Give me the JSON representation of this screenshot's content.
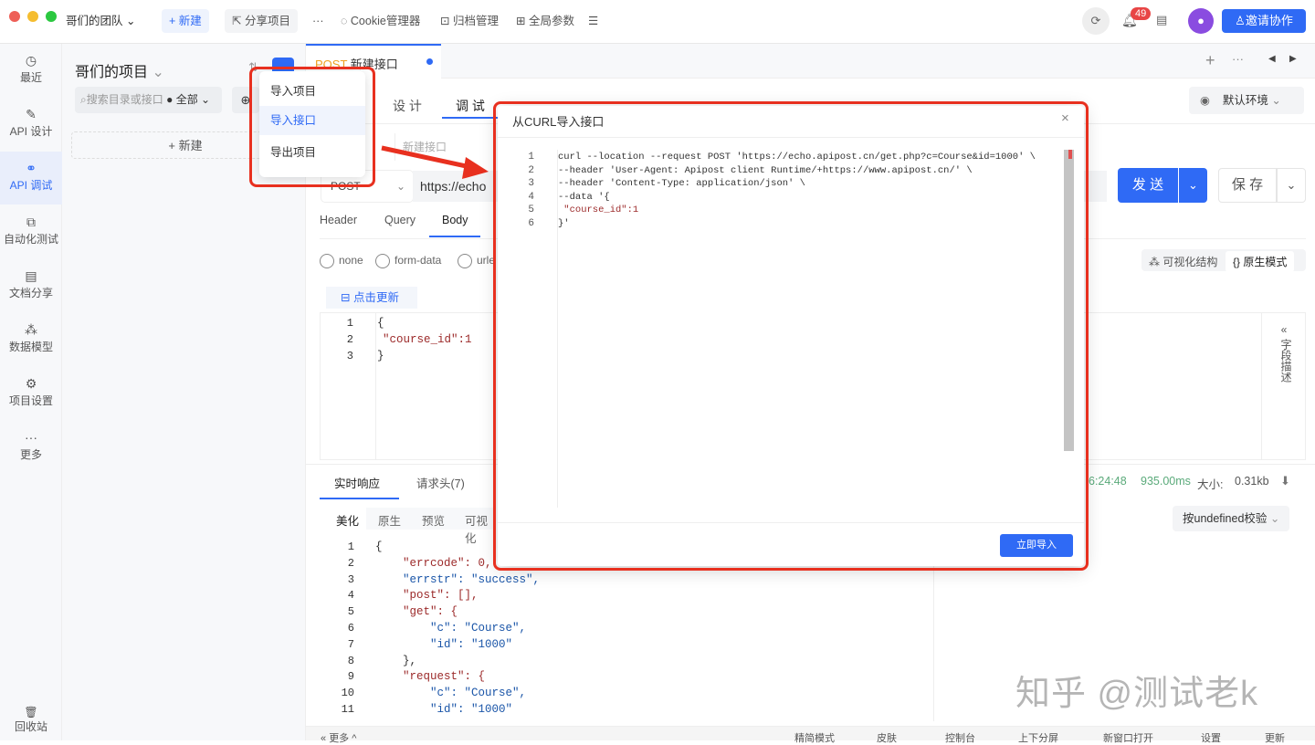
{
  "topbar": {
    "team": "哥们的团队",
    "new_label": "+ 新建",
    "share_label": "分享项目",
    "more": "···",
    "cookie_label": "Cookie管理器",
    "archive_label": "归档管理",
    "global_params_label": "全局参数",
    "notification_count": "49",
    "invite_label": "邀请协作"
  },
  "leftnav": [
    {
      "label": "最近",
      "icon": "clock-icon",
      "glyph": "◷"
    },
    {
      "label": "API 设计",
      "icon": "edit-icon",
      "glyph": "✎"
    },
    {
      "label": "API 调试",
      "icon": "link-icon",
      "glyph": "⚭"
    },
    {
      "label": "自动化测试",
      "icon": "flow-icon",
      "glyph": "⧉"
    },
    {
      "label": "文档分享",
      "icon": "doc-icon",
      "glyph": "▤"
    },
    {
      "label": "数据模型",
      "icon": "model-icon",
      "glyph": "⁂"
    },
    {
      "label": "项目设置",
      "icon": "settings-icon",
      "glyph": "⚙"
    },
    {
      "label": "更多",
      "icon": "more-icon",
      "glyph": "···"
    }
  ],
  "trash_label": "回收站",
  "project": {
    "title": "哥们的项目",
    "search_placeholder": "搜索目录或接口",
    "filter": "全部",
    "new_label": "+ 新建"
  },
  "import_menu": [
    "导入项目",
    "导入接口",
    "导出项目"
  ],
  "tab": {
    "method": "POST",
    "name": "新建接口"
  },
  "subtabs": [
    "设 计",
    "调 试"
  ],
  "env": "默认环境",
  "request": {
    "name_placeholder": "新建接口",
    "method": "POST",
    "url": "https://echo",
    "send": "发 送",
    "save": "保 存"
  },
  "param_tabs": [
    "Header",
    "Query",
    "Body"
  ],
  "body_types": [
    "none",
    "form-data",
    "urle"
  ],
  "refresh_label": "点击更新",
  "view_modes": [
    "可视化结构",
    "原生模式"
  ],
  "field_desc": "字段描述",
  "body_code": [
    "{",
    "\"course_id\":1",
    "}"
  ],
  "response": {
    "tabs": [
      "实时响应",
      "请求头(7)"
    ],
    "time": "6:24:48",
    "duration": "935.00ms",
    "size_label": "大小:",
    "size": "0.31kb",
    "format_tabs": [
      "美化",
      "原生",
      "预览",
      "可视化"
    ],
    "validate": "按undefined校验",
    "lines": [
      "{",
      "    \"errcode\": 0,",
      "    \"errstr\": \"success\",",
      "    \"post\": [],",
      "    \"get\": {",
      "        \"c\": \"Course\",",
      "        \"id\": \"1000\"",
      "    },",
      "    \"request\": {",
      "        \"c\": \"Course\",",
      "        \"id\": \"1000\""
    ]
  },
  "footer": {
    "more": "更多",
    "items": [
      "精简模式",
      "皮肤",
      "控制台",
      "上下分屏",
      "新窗口打开",
      "设置",
      "更新"
    ]
  },
  "modal": {
    "title": "从CURL导入接口",
    "close": "×",
    "lines": [
      "curl --location --request POST 'https://echo.apipost.cn/get.php?c=Course&id=1000' \\",
      "--header 'User-Agent: Apipost client Runtime/+https://www.apipost.cn/' \\",
      "--header 'Content-Type: application/json' \\",
      "--data '{",
      " \"course_id\":1",
      "}'"
    ],
    "import_button": "立即导入"
  },
  "watermark": "知乎 @测试老k",
  "colors": {
    "accent": "#2f6af5",
    "highlight": "#e8301f",
    "post": "#f0a020"
  }
}
